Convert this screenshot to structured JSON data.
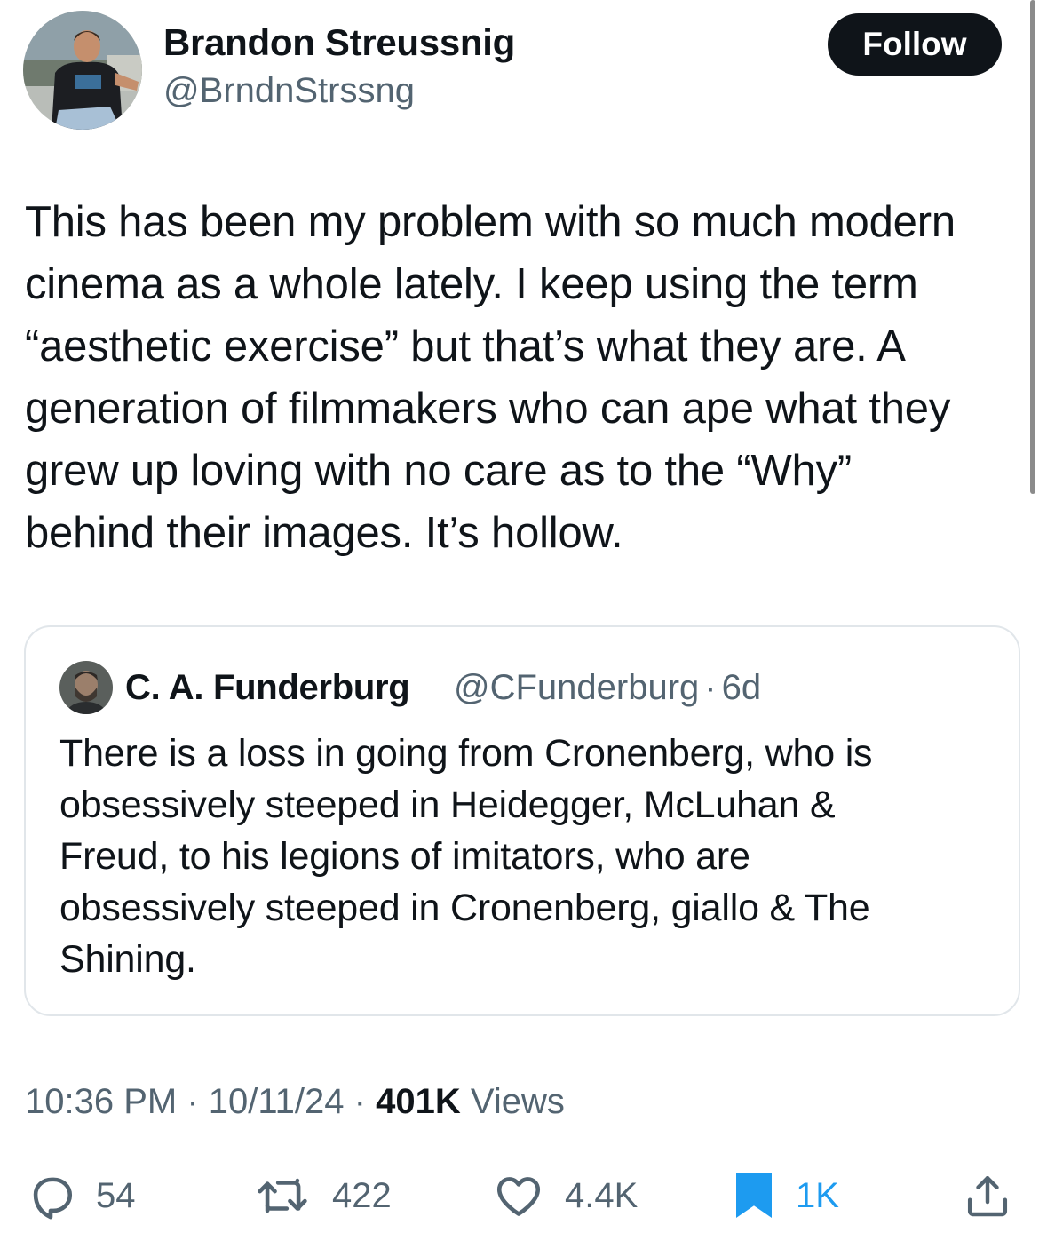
{
  "author": {
    "name": "Brandon Streussnig",
    "handle": "@BrndnStrssng",
    "follow_label": "Follow"
  },
  "tweet": {
    "text": "This has been my problem with so much modern\ncinema as a whole lately. I keep using the term\n“aesthetic exercise” but that’s what they are. A\ngeneration of filmmakers who can ape what they\ngrew up loving with no care as to the “Why”\nbehind their images. It’s hollow."
  },
  "quote": {
    "name": "C. A. Funderburg",
    "handle": "@CFunderburg",
    "separator": "·",
    "age": "6d",
    "text": "There is a loss in going from Cronenberg, who is\nobsessively steeped in Heidegger, McLuhan &\nFreud, to his legions of imitators, who are\nobsessively steeped in Cronenberg, giallo & The\nShining."
  },
  "meta": {
    "time": "10:36 PM",
    "separator": "·",
    "date": "10/11/24",
    "views_count": "401K",
    "views_label": "Views"
  },
  "actions": {
    "replies": "54",
    "reposts": "422",
    "likes": "4.4K",
    "bookmarks": "1K"
  },
  "colors": {
    "text": "#0f1419",
    "secondary": "#536471",
    "accent_blue": "#1d9bf0",
    "border": "#e1e6ea"
  },
  "icons": {
    "reply": "speech-bubble-icon",
    "repost": "repost-arrows-icon",
    "like": "heart-icon",
    "bookmark": "bookmark-filled-icon",
    "share": "share-upload-icon"
  }
}
